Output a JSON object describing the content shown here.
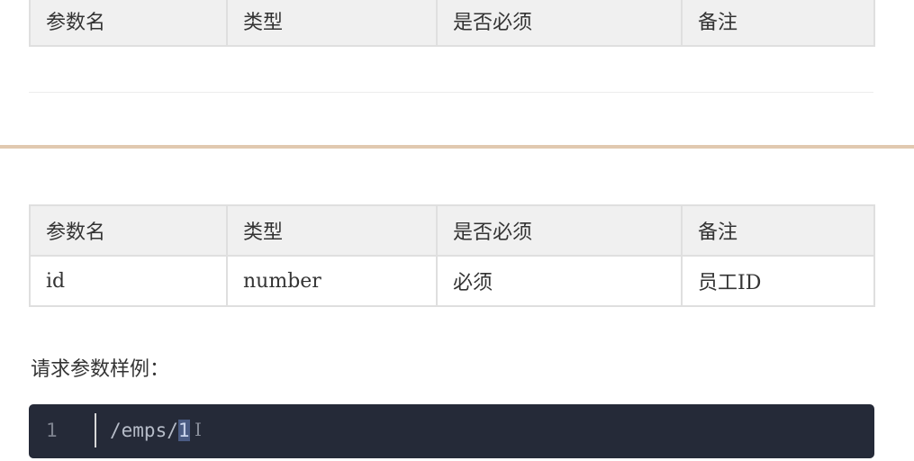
{
  "tables": {
    "top": {
      "headers": [
        "参数名",
        "类型",
        "是否必须",
        "备注"
      ]
    },
    "main": {
      "headers": [
        "参数名",
        "类型",
        "是否必须",
        "备注"
      ],
      "rows": [
        [
          "id",
          "number",
          "必须",
          "员工ID"
        ]
      ]
    }
  },
  "request_example": {
    "caption": "请求参数样例：",
    "line_number": "1",
    "code_prefix": "/emps/",
    "code_selected": "1",
    "cursor_glyph": "I"
  }
}
